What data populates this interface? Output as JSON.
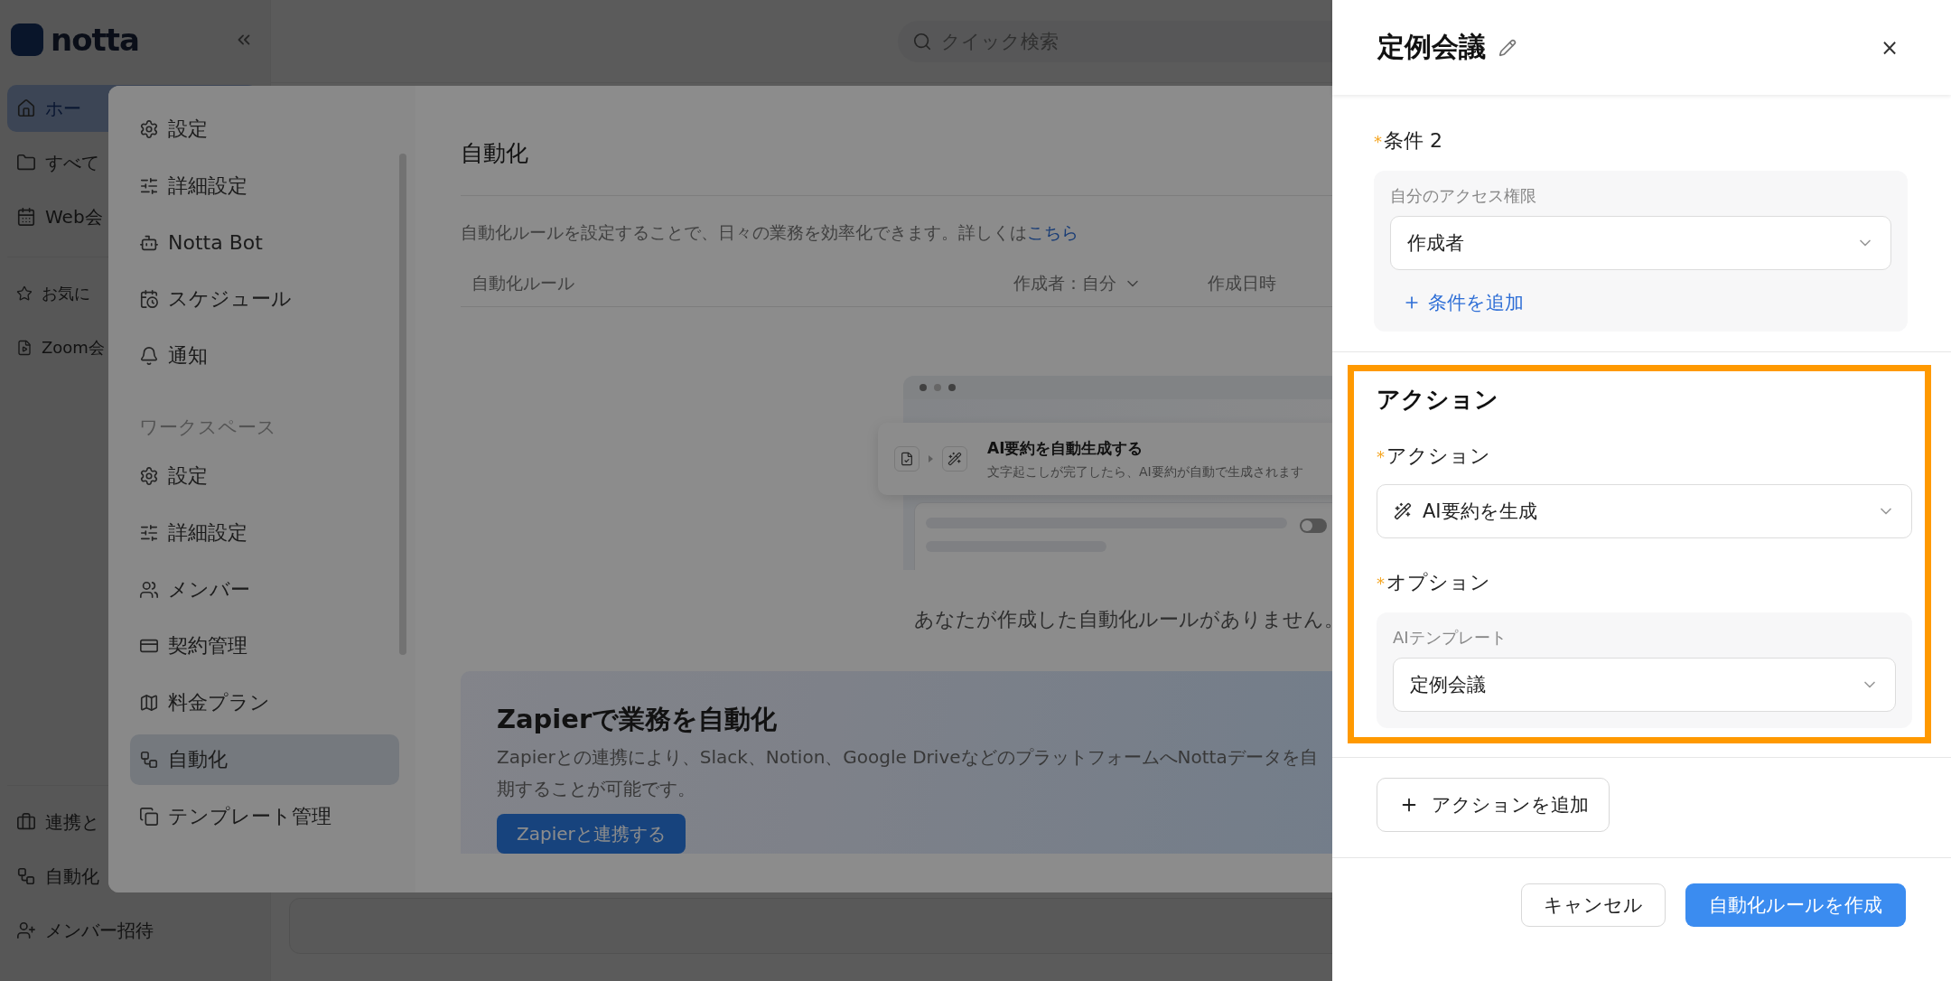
{
  "app_sidebar": {
    "logo": "notta",
    "items": [
      {
        "label": "ホー",
        "selected": true
      },
      {
        "label": "すべて",
        "selected": false
      },
      {
        "label": "Web会",
        "selected": false
      }
    ],
    "favorites": [
      {
        "label": "お気に",
        "selected": false
      },
      {
        "label": "Zoom会",
        "selected": false
      }
    ],
    "bottom_items": [
      {
        "label": "連携と",
        "selected": false
      },
      {
        "label": "自動化",
        "selected": false
      },
      {
        "label": "メンバー招待",
        "selected": false
      }
    ]
  },
  "search": {
    "placeholder": "クイック検索"
  },
  "settings_modal": {
    "nav": {
      "personal": [
        {
          "label": "設定",
          "selected": false
        },
        {
          "label": "詳細設定",
          "selected": false
        },
        {
          "label": "Notta Bot",
          "selected": false
        },
        {
          "label": "スケジュール",
          "selected": false
        },
        {
          "label": "通知",
          "selected": false
        }
      ],
      "section_label": "ワークスペース",
      "workspace": [
        {
          "label": "設定",
          "selected": false
        },
        {
          "label": "詳細設定",
          "selected": false
        },
        {
          "label": "メンバー",
          "selected": false
        },
        {
          "label": "契約管理",
          "selected": false
        },
        {
          "label": "料金プラン",
          "selected": false
        },
        {
          "label": "自動化",
          "selected": true
        },
        {
          "label": "テンプレート管理",
          "selected": false
        }
      ]
    },
    "content": {
      "title": "自動化",
      "description": "自動化ルールを設定することで、日々の業務を効率化できます。詳しくは",
      "link": "こちら",
      "table": {
        "columns": [
          {
            "label": "自動化ルール",
            "kind": "plain"
          },
          {
            "label": "作成者：自分",
            "kind": "dropdown"
          },
          {
            "label": "作成日時",
            "kind": "plain"
          }
        ]
      },
      "illustration": {
        "title": "AI要約を自動生成する",
        "subtitle": "文字起こしが完了したら、AI要約が自動で生成されます",
        "toggle_on": false
      },
      "empty_text": "あなたが作成した自動化ルールがありません。",
      "zapier": {
        "title": "Zapierで業務を自動化",
        "description_lines": [
          "Zapierとの連携により、Slack、Notion、Google DriveなどのプラットフォームへNottaデータを自",
          "期することが可能です。"
        ],
        "button": "Zapierと連携する"
      }
    }
  },
  "drawer": {
    "title": "定例会議",
    "close": "×",
    "condition": {
      "marker": "*",
      "label": "条件 2",
      "field_label": "自分のアクセス権限",
      "value": "作成者",
      "add_link": "条件を追加"
    },
    "action_section": {
      "heading": "アクション",
      "action_marker": "*",
      "action_label": "アクション",
      "action_value": "AI要約を生成",
      "option_marker": "*",
      "option_label": "オプション",
      "template_label": "AIテンプレート",
      "template_value": "定例会議"
    },
    "add_action_button": "アクションを追加",
    "footer": {
      "cancel": "キャンセル",
      "create": "自動化ルールを作成"
    }
  }
}
